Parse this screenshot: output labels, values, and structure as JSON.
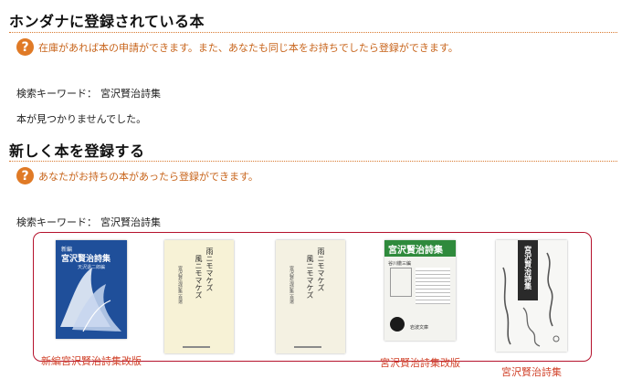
{
  "registered": {
    "heading": "ホンダナに登録されている本",
    "notice": "在庫があれば本の申請ができます。また、あなたも同じ本をお持ちでしたら登録ができます。",
    "search_label": "検索キーワード：",
    "search_keyword": "宮沢賢治詩集",
    "no_results": "本が見つかりませんでした。"
  },
  "register_new": {
    "heading": "新しく本を登録する",
    "notice": "あなたがお持ちの本があったら登録ができます。",
    "search_label": "検索キーワード：",
    "search_keyword": "宮沢賢治詩集"
  },
  "results": [
    {
      "title": "新編宮沢賢治詩集改版",
      "cover_text": [
        "新編",
        "宮沢賢治詩集",
        "天沢退二郎編"
      ],
      "cover_color": "#1f4f9a"
    },
    {
      "title": "",
      "cover_text": [
        "雨ニモマケズ",
        "風ニモマケズ",
        "宮沢賢治詩集 百選"
      ],
      "cover_color": "#f7f2d6"
    },
    {
      "title": "",
      "cover_text": [
        "雨ニモマケズ",
        "風ニモマケズ",
        "宮沢賢治詩集 百選"
      ],
      "cover_color": "#f4f1e2"
    },
    {
      "title": "宮沢賢治詩集改版",
      "cover_text": [
        "宮沢賢治詩集",
        "谷川徹三編",
        "岩波文庫"
      ],
      "cover_color": "#2f8a3c"
    },
    {
      "title": "宮沢賢治詩集",
      "cover_text": [
        "宮沢賢治詩集"
      ],
      "cover_color": "#2a2a2a"
    }
  ],
  "colors": {
    "accent": "#e07a26",
    "notice_text": "#c8651c",
    "results_border": "#b5122c",
    "book_title": "#d1422a"
  }
}
